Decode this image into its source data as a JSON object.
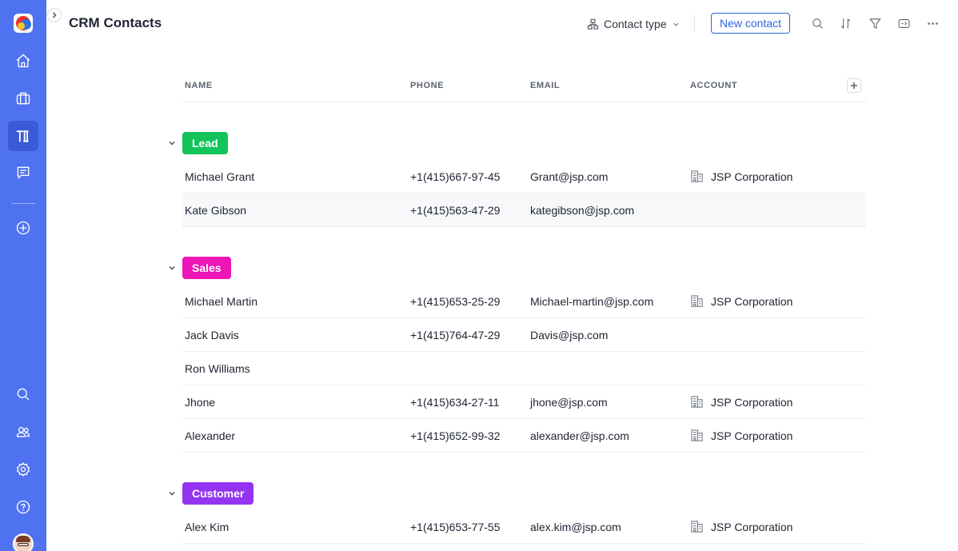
{
  "header": {
    "title": "CRM Contacts",
    "group_by_label": "Contact type",
    "new_contact_label": "New contact"
  },
  "table": {
    "columns": [
      "NAME",
      "PHONE",
      "EMAIL",
      "ACCOUNT"
    ]
  },
  "groups": [
    {
      "label": "Lead",
      "color": "#12c45a",
      "rows": [
        {
          "name": "Michael Grant",
          "phone": "+1(415)667-97-45",
          "email": "Grant@jsp.com",
          "account": "JSP Corporation"
        },
        {
          "name": "Kate Gibson",
          "phone": "+1(415)563-47-29",
          "email": "kategibson@jsp.com",
          "account": ""
        }
      ]
    },
    {
      "label": "Sales",
      "color": "#ee16b6",
      "rows": [
        {
          "name": "Michael Martin",
          "phone": "+1(415)653-25-29",
          "email": "Michael-martin@jsp.com",
          "account": "JSP Corporation"
        },
        {
          "name": "Jack Davis",
          "phone": "+1(415)764-47-29",
          "email": "Davis@jsp.com",
          "account": ""
        },
        {
          "name": "Ron Williams",
          "phone": "",
          "email": "",
          "account": ""
        },
        {
          "name": "Jhone",
          "phone": "+1(415)634-27-11",
          "email": "jhone@jsp.com",
          "account": "JSP Corporation"
        },
        {
          "name": "Alexander",
          "phone": "+1(415)652-99-32",
          "email": "alexander@jsp.com",
          "account": "JSP Corporation"
        }
      ]
    },
    {
      "label": "Customer",
      "color": "#9434f0",
      "rows": [
        {
          "name": "Alex Kim",
          "phone": "+1(415)653-77-55",
          "email": "alex.kim@jsp.com",
          "account": "JSP Corporation"
        }
      ]
    }
  ],
  "sidebar": {
    "nav_icons": [
      "home-icon",
      "briefcase-icon",
      "crm-app-icon",
      "chat-icon",
      "add-circle-icon"
    ],
    "bottom_icons": [
      "search-icon",
      "users-icon",
      "settings-icon",
      "help-icon"
    ]
  },
  "toolbar_icons": [
    "search-icon",
    "sort-icon",
    "filter-icon",
    "view-toggle-icon",
    "more-icon"
  ]
}
